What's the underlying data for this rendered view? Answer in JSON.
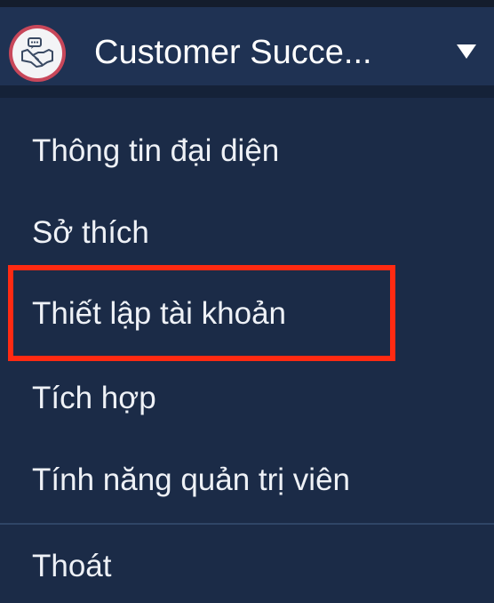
{
  "header": {
    "org_name": "Customer Succe...",
    "avatar_icon": "handshake-icon",
    "dropdown_icon": "triangle-down-icon"
  },
  "menu": {
    "items": [
      {
        "label": "Thông tin đại diện"
      },
      {
        "label": "Sở thích"
      },
      {
        "label": "Thiết lập tài khoản"
      },
      {
        "label": "Tích hợp"
      },
      {
        "label": "Tính năng quản trị viên"
      }
    ],
    "logout_label": "Thoát"
  },
  "colors": {
    "background": "#1b2b47",
    "header_background": "#1f3253",
    "text": "#eef1f6",
    "highlight": "#ff2a12",
    "avatar_ring": "#c8475a"
  }
}
